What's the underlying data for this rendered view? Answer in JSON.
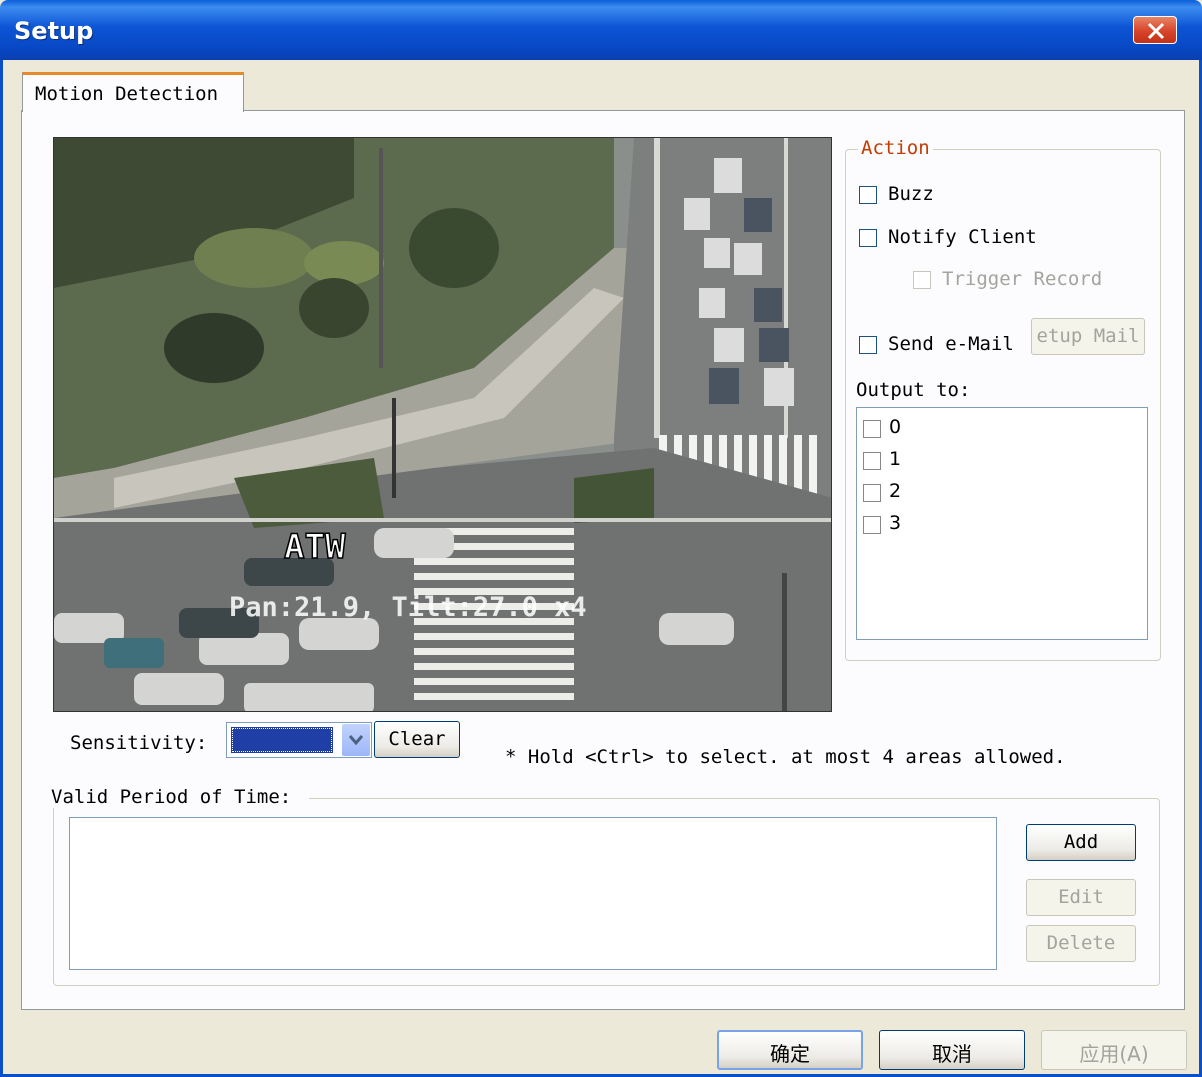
{
  "window": {
    "title": "Setup"
  },
  "tabs": [
    {
      "label": "Motion Detection",
      "active": true
    }
  ],
  "video": {
    "osd_line1": "ATW",
    "osd_line2": "Pan:21.9, Tilt:27.0 x4"
  },
  "action": {
    "title": "Action",
    "buzz": {
      "label": "Buzz",
      "checked": false
    },
    "notify_client": {
      "label": "Notify Client",
      "checked": false
    },
    "trigger_record": {
      "label": "Trigger Record",
      "checked": false,
      "enabled": false
    },
    "send_email": {
      "label": "Send e-Mail",
      "checked": false
    },
    "setup_mail_label": "etup Mail",
    "output_label": "Output to:",
    "outputs": [
      "0",
      "1",
      "2",
      "3"
    ]
  },
  "sensitivity": {
    "label": "Sensitivity:",
    "clear_label": "Clear",
    "selected_color": "#1f3fa6"
  },
  "hint": "* Hold <Ctrl> to select. at most 4 areas allowed.",
  "valid_period": {
    "title": "Valid Period of Time:",
    "add_label": "Add",
    "edit_label": "Edit",
    "delete_label": "Delete"
  },
  "footer": {
    "ok_label": "确定",
    "cancel_label": "取消",
    "apply_label": "应用(A)"
  },
  "colors": {
    "titlebar": "#0a55d6",
    "accent_tab": "#e68b2c",
    "group_title": "#c43c00"
  }
}
